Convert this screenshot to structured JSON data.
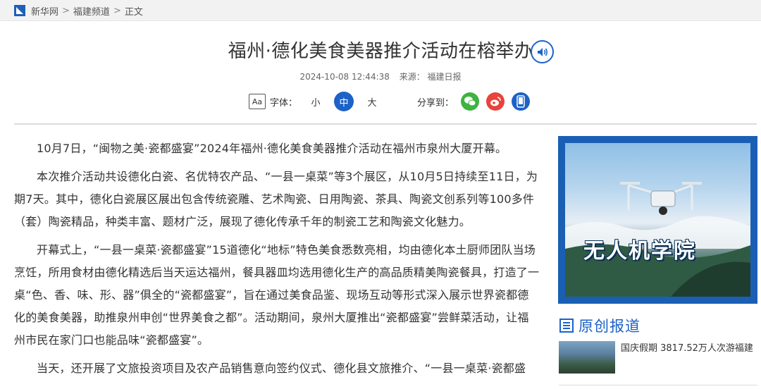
{
  "breadcrumb": {
    "items": [
      "新华网",
      "福建频道",
      "正文"
    ],
    "separator": ">"
  },
  "article": {
    "title": "福州·德化美食美器推介活动在榕举办",
    "datetime": "2024-10-08 12:44:38",
    "source": "来源： 福建日报",
    "paragraphs": [
      "10月7日，“闽物之美·瓷都盛宴”2024年福州·德化美食美器推介活动在福州市泉州大厦开幕。",
      "本次推介活动共设德化白瓷、名优特农产品、“一县一桌菜”等3个展区，从10月5日持续至11日，为期7天。其中，德化白瓷展区展出包含传统瓷雕、艺术陶瓷、日用陶瓷、茶具、陶瓷文创系列等100多件（套）陶瓷精品，种类丰富、题材广泛，展现了德化传承千年的制瓷工艺和陶瓷文化魅力。",
      "开幕式上，“一县一桌菜·瓷都盛宴”15道德化“地标”特色美食悉数亮相，均由德化本土厨师团队当场烹饪，所用食材由德化精选后当天运达福州，餐具器皿均选用德化生产的高品质精美陶瓷餐具，打造了一桌“色、香、味、形、器”俱全的“瓷都盛宴”，旨在通过美食品鉴、现场互动等形式深入展示世界瓷都德化的美食美器，助推泉州申创“世界美食之都”。活动期间，泉州大厦推出“瓷都盛宴”尝鲜菜活动，让福州市民在家门口也能品味“瓷都盛宴”。",
      "当天，还开展了文旅投资项目及农产品销售意向签约仪式、德化县文旅推介、“一县一桌菜·瓷都盛"
    ]
  },
  "tools": {
    "font_label": "字体：",
    "font_icon_text": "Aa",
    "sizes": [
      "小",
      "中",
      "大"
    ],
    "active_size": "中",
    "share_label": "分享到："
  },
  "sidebar": {
    "ad_text": "无人机学院",
    "section_title": "原创报道",
    "news": [
      {
        "title": "国庆假期 3817.52万人次游福建"
      }
    ]
  },
  "colors": {
    "accent": "#1c62c7",
    "wechat": "#3fb33f",
    "weibo": "#e6443c",
    "mobile": "#1c62c7"
  }
}
